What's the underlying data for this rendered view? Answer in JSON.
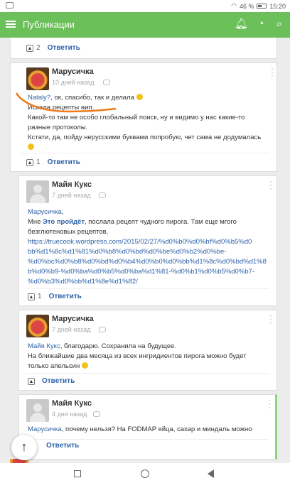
{
  "status": {
    "battery": "46 %",
    "time": "15:20"
  },
  "appbar": {
    "title": "Публикации"
  },
  "top_footer": {
    "likes": "2",
    "reply": "Ответить"
  },
  "comments": [
    {
      "author": "Марусичка",
      "date": "10 дней назад",
      "mention": "Nataly?",
      "line1": ", ок, спасибо, так и делала",
      "line2": "Искала рецепты аип.",
      "line3": "Какой-то там не особо глобальный поиск, ну и видимо у нас какие-то",
      "line4": "разные протоколы.",
      "line5": "Кстати, да, пойду нерусскими буквами попробую, чет сама не додумалась",
      "likes": "1",
      "reply": "Ответить"
    },
    {
      "author": "Майя Кукс",
      "date": "7 дней назад",
      "mention": "Марусичка",
      "line1_pre": "Мне ",
      "line1_bold": "Это пройдёт",
      "line1_post": ", послала рецепт чудного пирога. Там еще мгого",
      "line2": "безглютеновых рецептов.",
      "url": "https://truecook.wordpress.com/2015/02/27/%d0%b0%d0%bf%d0%b5%d0%bb%d1%8c%d1%81%d0%b8%d0%bd%d0%be%d0%b2%d0%be-%d0%bc%d0%b8%d0%bd%d0%b4%d0%b0%d0%bb%d1%8c%d0%bd%d1%8b%d0%b9-%d0%ba%d0%b5%d0%ba%d1%81-%d0%b1%d0%b5%d0%b7-%d0%b3%d0%bb%d1%8e%d1%82/",
      "url_l1": "https://truecook.wordpress.com/2015/02/27/%d0%b0%d0%bf%d0%b5%d0",
      "url_l2": "bb%d1%8c%d1%81%d0%b8%d0%bd%d0%be%d0%b2%d0%be-",
      "url_l3": "%d0%bc%d0%b8%d0%bd%d0%b4%d0%b0%d0%bb%d1%8c%d0%bd%d1%8",
      "url_l4": "b%d0%b9-%d0%ba%d0%b5%d0%ba%d1%81-%d0%b1%d0%b5%d0%b7-",
      "url_l5": "%d0%b3%d0%bb%d1%8e%d1%82/",
      "likes": "1",
      "reply": "Ответить"
    },
    {
      "author": "Марусичка",
      "date": "7 дней назад",
      "mention": "Майя Кукс",
      "line1": ", благодарю. Сохранила на будущее.",
      "line2": "На ближайшие два месяца из всех ингридиентов пирога можно будет",
      "line3": "только апельсин",
      "reply": "Ответить"
    },
    {
      "author": "Майя Кукс",
      "date": "4 дня назад",
      "mention": "Марусичка",
      "line1": ", почему нельзя? На  FODMAP яйца, сахар и миндаль можно",
      "reply": "Ответить"
    }
  ]
}
